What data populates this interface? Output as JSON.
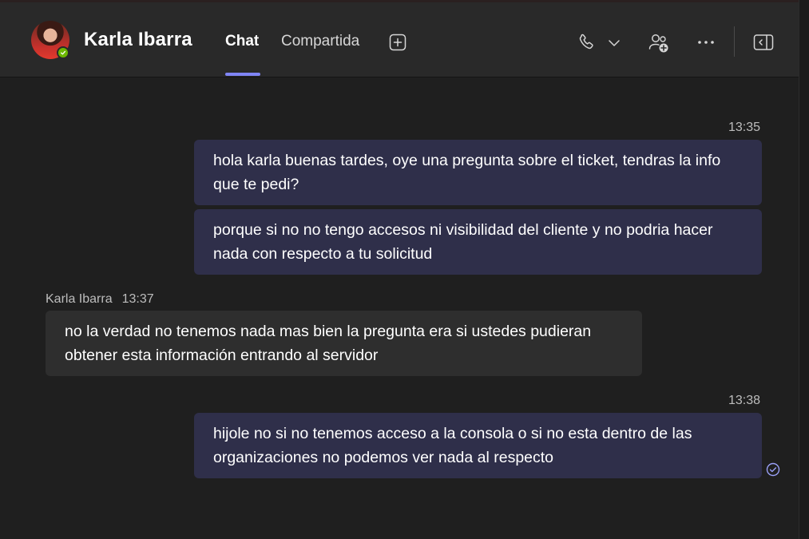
{
  "header": {
    "contact_name": "Karla Ibarra",
    "presence": "available",
    "tabs": [
      {
        "label": "Chat",
        "active": true
      },
      {
        "label": "Compartida",
        "active": false
      }
    ],
    "icons": [
      "add-tab-icon",
      "phone-icon",
      "chevron-down-icon",
      "add-people-icon",
      "more-options-icon",
      "side-panel-icon"
    ]
  },
  "messages": [
    {
      "timestamp": "13:35",
      "from": "me",
      "text": "hola karla buenas tardes, oye una pregunta sobre el ticket, tendras la info que te pedi?"
    },
    {
      "from": "me",
      "text": "porque si no no tengo accesos ni visibilidad del cliente y no podria hacer nada con respecto a tu solicitud"
    },
    {
      "sender": "Karla Ibarra",
      "timestamp": "13:37",
      "from": "them",
      "text": "no la verdad no tenemos nada  mas bien la pregunta era si ustedes pudieran obtener esta información entrando al servidor"
    },
    {
      "timestamp": "13:38",
      "from": "me",
      "text": "hijole no si no tenemos acceso a la consola o si no esta dentro de las organizaciones no podemos ver nada al respecto",
      "status": "read"
    }
  ],
  "colors": {
    "background": "#1f1f1f",
    "header": "#292929",
    "accent": "#7f85f5",
    "my_bubble": "#2f2f4a",
    "their_bubble": "#2e2e2e",
    "presence": "#6bb700"
  }
}
